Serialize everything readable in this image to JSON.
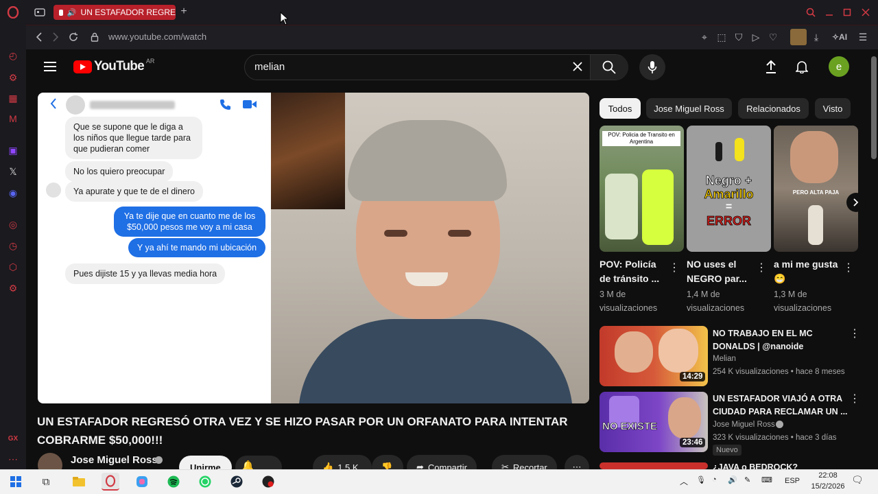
{
  "browser": {
    "tab_title": "UN ESTAFADOR REGRE",
    "new_tab": "+",
    "url": "www.youtube.com/watch",
    "ai_label": "AI",
    "sidebar_bottom_label": "GX"
  },
  "youtube": {
    "logo_text": "YouTube",
    "region": "AR",
    "search_value": "melian",
    "avatar_letter": "e",
    "video": {
      "chat": {
        "messages_in": [
          "Que se supone que le diga a los niños que llegue tarde para que pudieran comer",
          "No los quiero preocupar",
          "Ya apurate y que te de el dinero",
          "Pues dijiste 15 y ya llevas media hora"
        ],
        "messages_out": [
          "Ya te dije que en cuanto me de los $50,000 pesos me voy a mi casa",
          "Y ya ahí te mando mi ubicación"
        ]
      }
    },
    "title": "UN ESTAFADOR REGRESÓ OTRA VEZ Y SE HIZO PASAR POR UN ORFANATO PARA INTENTAR COBRARME $50,000!!!",
    "channel": "Jose Miguel Ross",
    "join_label": "Unirme",
    "likes": "1,5 K",
    "share_label": "Compartir",
    "clip_label": "Recortar",
    "chips": [
      "Todos",
      "Jose Miguel Ross",
      "Relacionados",
      "Visto"
    ],
    "shorts": [
      {
        "title": "POV: Policía de tránsito ...",
        "views": "3 M de visualizaciones",
        "overlay": "POV: Policia de Transito en Argentina"
      },
      {
        "title": "NO uses el NEGRO par...",
        "views": "1,4 M de visualizaciones",
        "overlay_1": "Negro +",
        "overlay_2": "Amarillo",
        "overlay_3": "=",
        "overlay_4": "ERROR"
      },
      {
        "title": "a mi me gusta 😁",
        "views": "1,3 M de visualizaciones",
        "overlay": "PERO ALTA PAJA"
      }
    ],
    "recommendations": [
      {
        "title": "NO TRABAJO EN EL MC DONALDS | @nanoide",
        "channel": "Melian",
        "meta": "254 K visualizaciones • hace 8 meses",
        "duration": "14:29"
      },
      {
        "title": "UN ESTAFADOR VIAJÓ A OTRA CIUDAD PARA RECLAMAR UN ...",
        "channel": "Jose Miguel Ross",
        "meta": "323 K visualizaciones • hace 3 días",
        "badge": "Nuevo",
        "duration": "23:46",
        "overlay": "NO EXISTE"
      },
      {
        "title": "¿JAVA o BEDROCK?"
      }
    ]
  },
  "taskbar": {
    "language": "ESP",
    "time": "22:08",
    "date": "15/2/2026"
  },
  "colors": {
    "opera_red": "#d23a44",
    "youtube_red": "#ff0000",
    "chat_blue": "#1f6fe5"
  }
}
